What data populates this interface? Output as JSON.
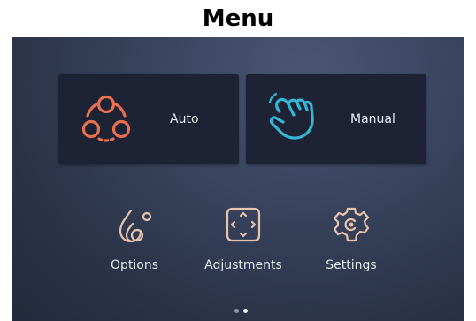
{
  "page": {
    "heading": "Menu"
  },
  "tiles": [
    {
      "label": "Auto",
      "icon": "cycle-nodes-icon",
      "color": "#e8704c"
    },
    {
      "label": "Manual",
      "icon": "hand-pointer-icon",
      "color": "#36b6d6"
    }
  ],
  "options": [
    {
      "label": "Options",
      "icon": "drops-icon"
    },
    {
      "label": "Adjustments",
      "icon": "adjust-arrows-icon"
    },
    {
      "label": "Settings",
      "icon": "gear-icon"
    }
  ],
  "pager": {
    "total": 2,
    "active": 2
  },
  "colors": {
    "accent_auto": "#e8704c",
    "accent_manual": "#36b6d6",
    "icon_secondary": "#e8c3ae",
    "tile_bg": "#1d2335",
    "screen_bg": "#2f3850"
  }
}
